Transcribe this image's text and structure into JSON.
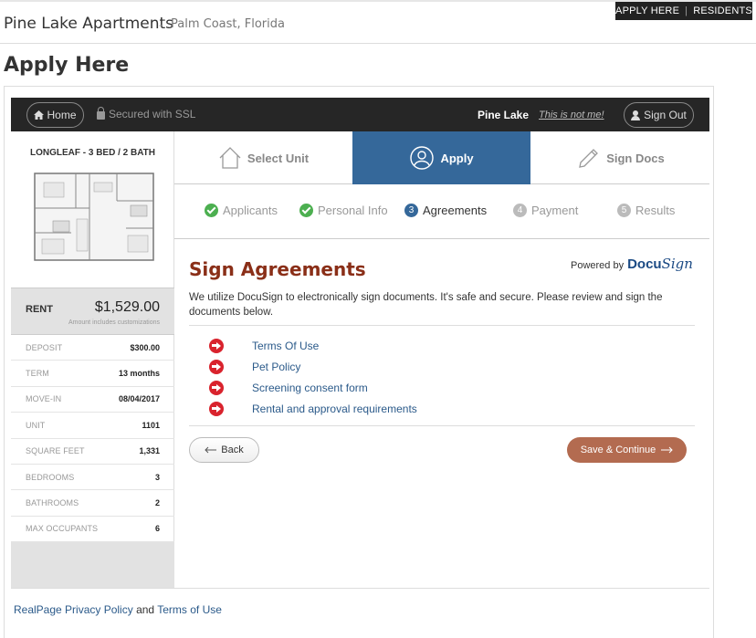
{
  "topnav": {
    "apply": "APPLY HERE",
    "sep": "|",
    "residents": "RESIDENTS"
  },
  "header": {
    "property": "Pine Lake Apartments",
    "sep": "-",
    "city": "Palm Coast, Florida"
  },
  "page_title": "Apply Here",
  "bar": {
    "home": "Home",
    "ssl": "Secured with SSL",
    "user": "Pine Lake",
    "not_me": "This is not me!",
    "sign_out": "Sign Out"
  },
  "unit": {
    "name": "LONGLEAF - 3 BED / 2 BATH",
    "rent_label": "RENT",
    "rent": "$1,529.00",
    "rent_note": "Amount includes customizations",
    "details": [
      {
        "k": "DEPOSIT",
        "v": "$300.00"
      },
      {
        "k": "TERM",
        "v": "13 months"
      },
      {
        "k": "MOVE-IN",
        "v": "08/04/2017"
      },
      {
        "k": "UNIT",
        "v": "1101"
      },
      {
        "k": "SQUARE FEET",
        "v": "1,331"
      },
      {
        "k": "BEDROOMS",
        "v": "3"
      },
      {
        "k": "BATHROOMS",
        "v": "2"
      },
      {
        "k": "MAX OCCUPANTS",
        "v": "6"
      }
    ]
  },
  "steps": [
    {
      "label": "Select Unit",
      "icon": "house-icon"
    },
    {
      "label": "Apply",
      "icon": "user-circle-icon"
    },
    {
      "label": "Sign Docs",
      "icon": "pen-icon"
    }
  ],
  "substeps": [
    {
      "label": "Applicants",
      "state": "done"
    },
    {
      "label": "Personal Info",
      "state": "done"
    },
    {
      "label": "Agreements",
      "num": "3",
      "state": "active"
    },
    {
      "label": "Payment",
      "num": "4",
      "state": "todo"
    },
    {
      "label": "Results",
      "num": "5",
      "state": "todo"
    }
  ],
  "content": {
    "title": "Sign Agreements",
    "powered_by": "Powered by",
    "docusign_a": "Docu",
    "docusign_b": "Sign",
    "intro": "We utilize DocuSign to electronically sign documents. It's safe and secure. Please review and sign the documents below.",
    "documents": [
      "Terms Of Use",
      "Pet Policy",
      "Screening consent form",
      "Rental and approval requirements"
    ],
    "back": "Back",
    "save": "Save & Continue"
  },
  "footer": {
    "privacy": "RealPage Privacy Policy",
    "and": "and",
    "terms": "Terms of Use"
  },
  "colors": {
    "step_active": "#35689a",
    "title": "#8a2f18",
    "save_button": "#b36b50",
    "doc_icon": "#d9232d",
    "check": "#4caf50"
  }
}
